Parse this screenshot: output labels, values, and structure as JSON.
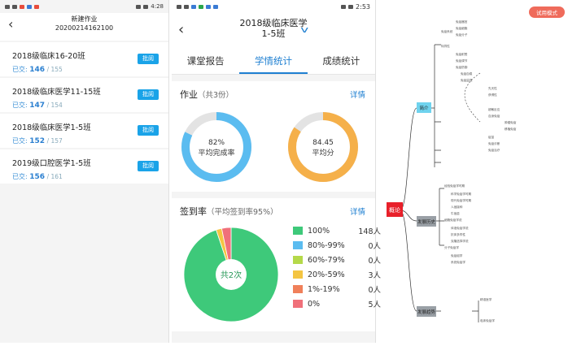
{
  "left": {
    "status": {
      "time": "4:28"
    },
    "header": {
      "title": "新建作业",
      "date": "20200214162100"
    },
    "items": [
      {
        "name": "2018级临床16-20班",
        "submitted_label": "已交:",
        "submitted": "146",
        "total": "/ 155",
        "button": "批阅"
      },
      {
        "name": "2018级临床医学11-15班",
        "submitted_label": "已交:",
        "submitted": "147",
        "total": "/ 154",
        "button": "批阅"
      },
      {
        "name": "2018级临床医学1-5班",
        "submitted_label": "已交:",
        "submitted": "152",
        "total": "/ 157",
        "button": "批阅"
      },
      {
        "name": "2019级口腔医学1-5班",
        "submitted_label": "已交:",
        "submitted": "156",
        "total": "/ 161",
        "button": "批阅"
      }
    ]
  },
  "mid": {
    "status": {
      "time": "2:53"
    },
    "header": {
      "line1": "2018级临床医学",
      "line2": "1-5班"
    },
    "tabs": [
      "课堂报告",
      "学情统计",
      "成绩统计"
    ],
    "homework": {
      "title": "作业",
      "count": "（共3份）",
      "detail": "详情",
      "completion": {
        "value": "82%",
        "label": "平均完成率",
        "fraction": 0.82,
        "color": "#5bbcf0"
      },
      "score": {
        "value": "84.45",
        "label": "平均分",
        "fraction": 0.8445,
        "color": "#f5b04a"
      }
    },
    "signin": {
      "title": "签到率",
      "sub": "（平均签到率95%）",
      "detail": "详情",
      "center": "共2次",
      "legend": [
        {
          "label": "100%",
          "count": "148人",
          "value": 148,
          "color": "#3ec97a"
        },
        {
          "label": "80%-99%",
          "count": "0人",
          "value": 0,
          "color": "#5bbcf0"
        },
        {
          "label": "60%-79%",
          "count": "0人",
          "value": 0,
          "color": "#b5d94a"
        },
        {
          "label": "20%-59%",
          "count": "3人",
          "value": 3,
          "color": "#f4c542"
        },
        {
          "label": "1%-19%",
          "count": "0人",
          "value": 0,
          "color": "#f0805a"
        },
        {
          "label": "0%",
          "count": "5人",
          "value": 5,
          "color": "#f0707a"
        }
      ]
    }
  },
  "right": {
    "trial_badge": "试用模式",
    "root": "概论",
    "branches": [
      "简介",
      "发展历史",
      "发展趋势"
    ],
    "leaf_labels": [
      "免疫系统",
      "免疫器官",
      "免疫细胞",
      "免疫分子",
      "特异性",
      "免疫耐受",
      "免疫调节",
      "免疫防御",
      "免疫自稳",
      "免疫监视",
      "先天性",
      "获得性",
      "超敏反应",
      "自身免疫",
      "肿瘤免疫",
      "移植免疫",
      "疫苗",
      "免疫诊断",
      "免疫治疗",
      "经验免疫学时期",
      "科学免疫学时期",
      "现代免疫学时期",
      "人痘接种",
      "牛痘苗",
      "细胞免疫学说",
      "体液免疫学说",
      "抗体多样性",
      "克隆选择学说",
      "分子免疫学",
      "免疫组学",
      "系统免疫学",
      "精准医学",
      "临床免疫学"
    ]
  }
}
